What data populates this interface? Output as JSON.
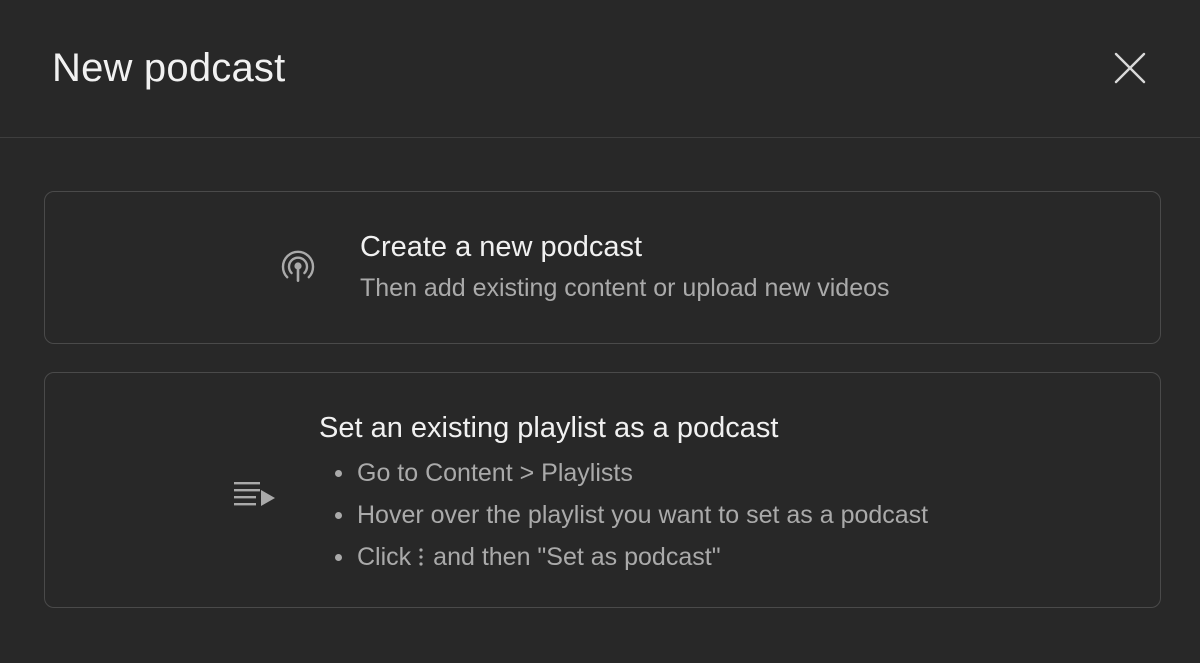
{
  "dialog": {
    "title": "New podcast",
    "close_icon": "close-icon"
  },
  "options": [
    {
      "icon": "podcast-broadcast-icon",
      "title": "Create a new podcast",
      "subtitle": "Then add existing content or upload new videos"
    },
    {
      "icon": "playlist-play-icon",
      "title": "Set an existing playlist as a podcast",
      "steps": [
        "Go to Content > Playlists",
        "Hover over the playlist you want to set as a podcast"
      ],
      "step3_prefix": "Click",
      "step3_icon": "more-vert-icon",
      "step3_suffix": "and then \"Set as podcast\""
    }
  ],
  "colors": {
    "background": "#282828",
    "text_primary": "#f1f1f1",
    "text_secondary": "#aaaaaa",
    "border": "#4a4a4a"
  }
}
